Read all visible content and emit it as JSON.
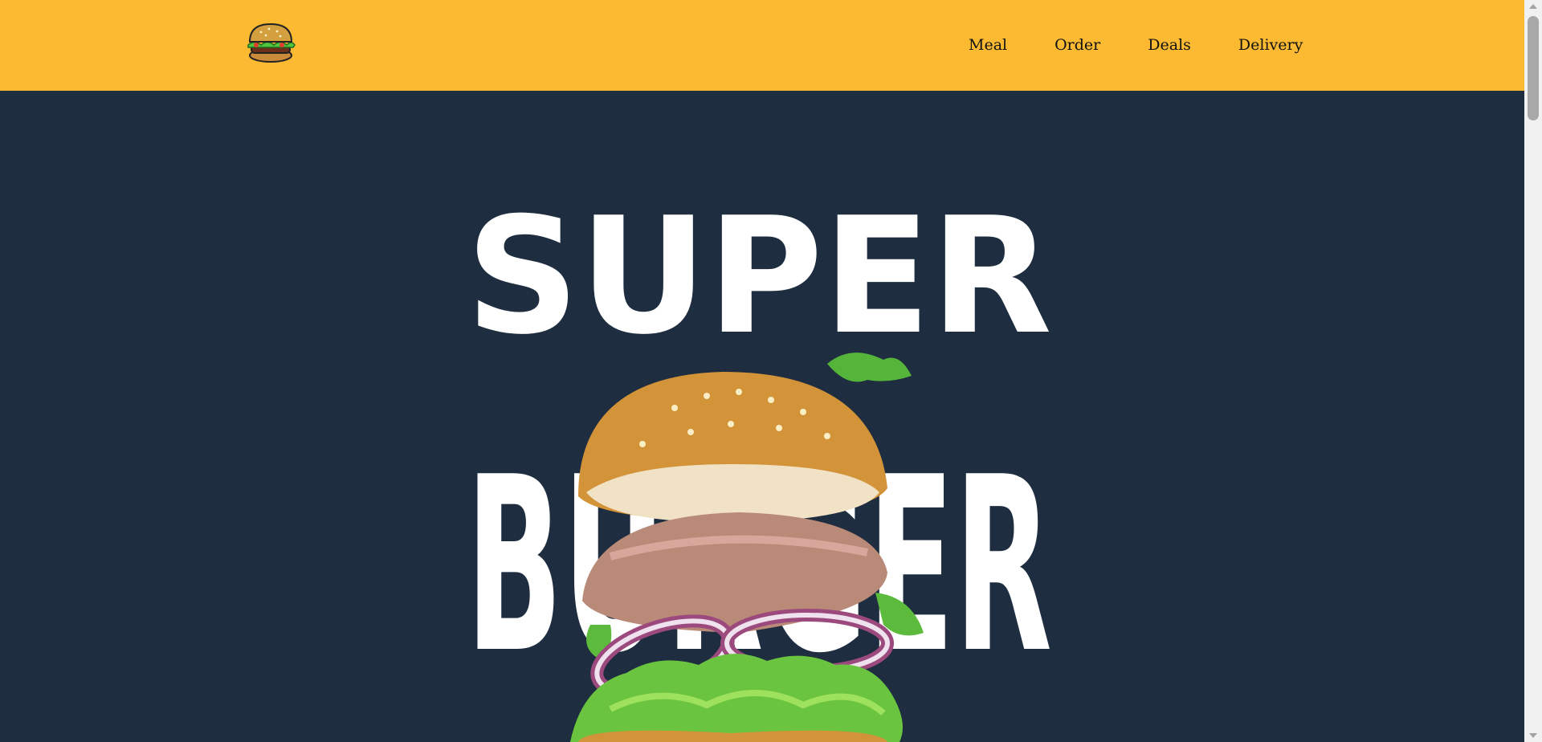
{
  "header": {
    "logo_icon": "burger-logo-icon",
    "nav": [
      {
        "label": "Meal"
      },
      {
        "label": "Order"
      },
      {
        "label": "Deals"
      },
      {
        "label": "Delivery"
      }
    ]
  },
  "hero": {
    "line1": "SUPER",
    "line2": "BURGER",
    "image_icon": "exploded-burger-image"
  },
  "colors": {
    "header_bg": "#fbba31",
    "hero_bg": "#1f2d40",
    "text_hero": "#ffffff"
  }
}
